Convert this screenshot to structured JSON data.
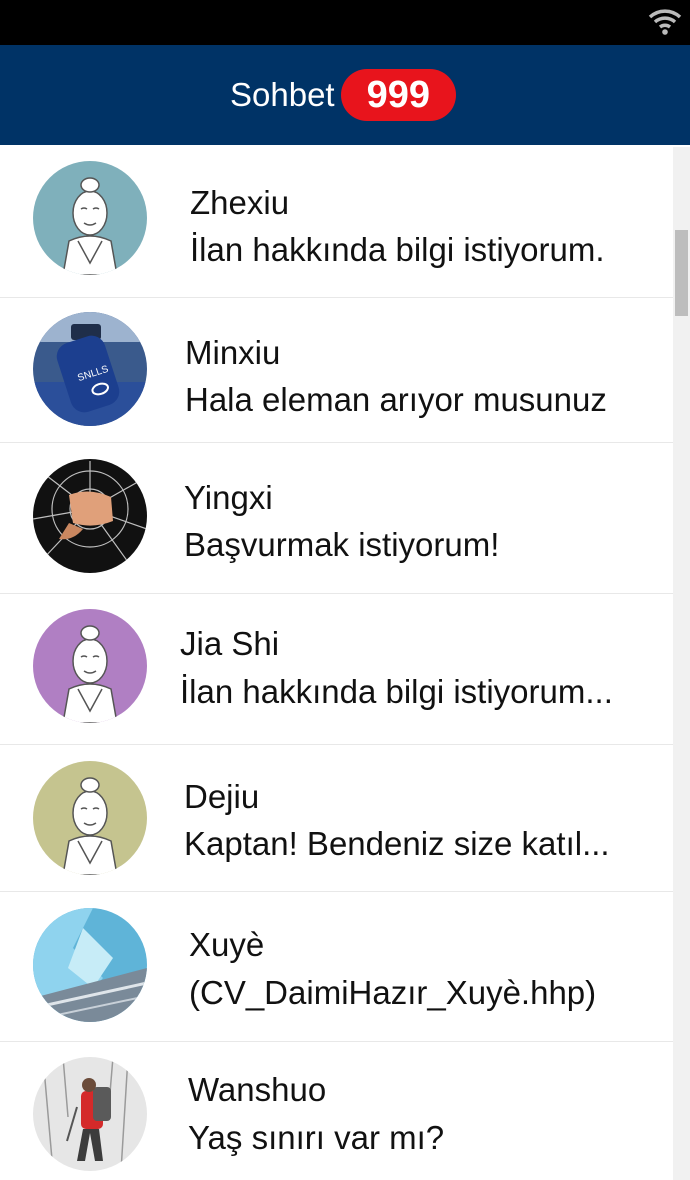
{
  "header": {
    "title": "Sohbet",
    "badge_count": "999"
  },
  "colors": {
    "header_bg": "#003366",
    "badge_bg": "#e8141c",
    "status_bar": "#000000"
  },
  "chats": [
    {
      "name": "Zhexiu",
      "message": "İlan hakkında bilgi istiyorum.",
      "avatar": "monk-avatar-teal"
    },
    {
      "name": "Minxiu",
      "message": "Hala eleman arıyor musunuz",
      "avatar": "water-bottle-photo"
    },
    {
      "name": "Yingxi",
      "message": "Başvurmak istiyorum!",
      "avatar": "fist-breaking-glass-photo"
    },
    {
      "name": "Jia Shi",
      "message": "İlan hakkında bilgi istiyorum...",
      "avatar": "monk-avatar-purple"
    },
    {
      "name": "Dejiu",
      "message": "Kaptan! Bendeniz size katıl...",
      "avatar": "monk-avatar-olive"
    },
    {
      "name": "Xuyè",
      "message": "(CV_DaimiHazır_Xuyè.hhp)",
      "avatar": "glacier-photo"
    },
    {
      "name": "Wanshuo",
      "message": "Yaş sınırı var mı?",
      "avatar": "hiker-snow-photo"
    }
  ]
}
